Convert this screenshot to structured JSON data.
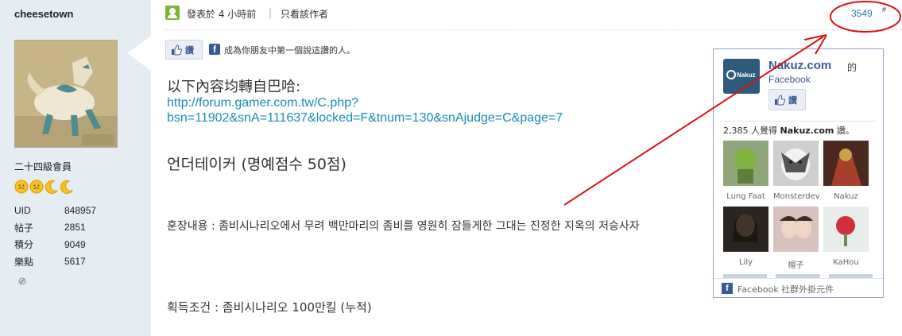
{
  "user": {
    "name": "cheesetown",
    "rank": "二十四級會員",
    "stats": [
      {
        "label": "UID",
        "value": "848957"
      },
      {
        "label": "帖子",
        "value": "2851"
      },
      {
        "label": "積分",
        "value": "9049"
      },
      {
        "label": "樂點",
        "value": "5617"
      }
    ]
  },
  "post": {
    "time": "發表於 4 小時前",
    "separator": "|",
    "only_author": "只看該作者",
    "number": "3549",
    "number_suffix": "#",
    "like_label": "讚",
    "like_text": "成為你朋友中第一個說這讚的人。"
  },
  "content": {
    "heading": "以下內容均轉自巴哈:",
    "link_line1": "http://forum.gamer.com.tw/C.php?",
    "link_line2": "bsn=11902&snA=111637&locked=F&tnum=130&snAjudge=C&page=7",
    "title_kr": "언더테이커 (명예점수 50점)",
    "desc_kr": "훈장내용 : 좀비시나리오에서 무려 백만마리의 좀비를 영원히 잠들게한 그대는 진정한 지옥의 저승사자",
    "cond_kr": "획득조건 : 좀비시나리오 100만킬 (누적)"
  },
  "facebook_widget": {
    "logo_text": "Nakuz",
    "page_name": "Nakuz.com",
    "page_suffix": "的",
    "page_sub": "Facebook",
    "like_label": "讚",
    "count_prefix": "2,385 人覺得",
    "count_name": "Nakuz.com",
    "count_suffix": "讚。",
    "fans": [
      {
        "name": "Lung Faat"
      },
      {
        "name": "Monsterdev"
      },
      {
        "name": "Nakuz"
      },
      {
        "name": "Lily"
      },
      {
        "name": "帽子"
      },
      {
        "name": "KaHou"
      }
    ],
    "footer": "Facebook 社群外掛元件"
  },
  "colors": {
    "sidebar_bg": "#e5edf2",
    "link": "#1a8bb9",
    "facebook_blue": "#3b5998",
    "annotation_red": "#dd1111"
  }
}
